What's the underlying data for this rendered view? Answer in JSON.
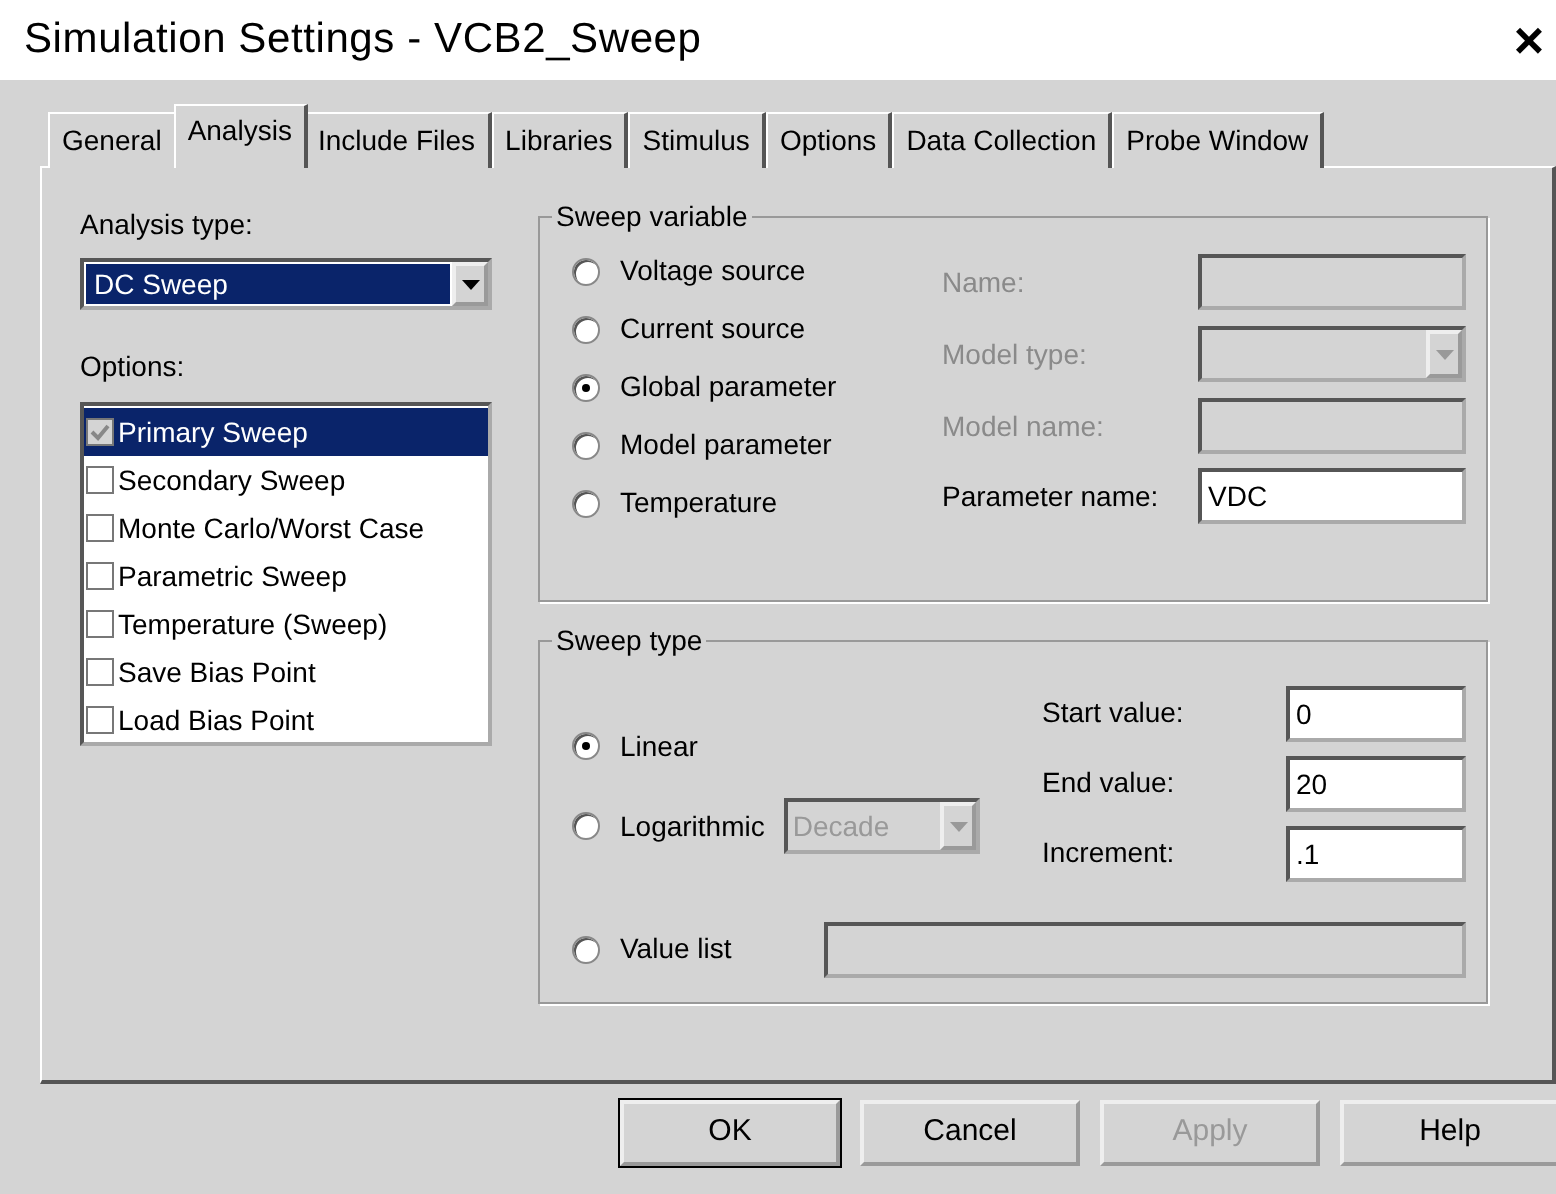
{
  "window": {
    "title": "Simulation Settings - VCB2_Sweep",
    "close": "×"
  },
  "tabs": [
    {
      "label": "General",
      "selected": false
    },
    {
      "label": "Analysis",
      "selected": true
    },
    {
      "label": "Include Files",
      "selected": false
    },
    {
      "label": "Libraries",
      "selected": false
    },
    {
      "label": "Stimulus",
      "selected": false
    },
    {
      "label": "Options",
      "selected": false
    },
    {
      "label": "Data Collection",
      "selected": false
    },
    {
      "label": "Probe Window",
      "selected": false
    }
  ],
  "analysis_type": {
    "label": "Analysis type:",
    "value": "DC Sweep"
  },
  "options": {
    "label": "Options:",
    "items": [
      {
        "label": "Primary Sweep",
        "checked": true,
        "selected": true,
        "disabled": true
      },
      {
        "label": "Secondary Sweep",
        "checked": false,
        "selected": false,
        "disabled": false
      },
      {
        "label": "Monte Carlo/Worst Case",
        "checked": false,
        "selected": false,
        "disabled": false
      },
      {
        "label": "Parametric Sweep",
        "checked": false,
        "selected": false,
        "disabled": false
      },
      {
        "label": "Temperature (Sweep)",
        "checked": false,
        "selected": false,
        "disabled": false
      },
      {
        "label": "Save Bias Point",
        "checked": false,
        "selected": false,
        "disabled": false
      },
      {
        "label": "Load Bias Point",
        "checked": false,
        "selected": false,
        "disabled": false
      }
    ]
  },
  "sweep_variable": {
    "title": "Sweep variable",
    "options": [
      {
        "label": "Voltage source",
        "selected": false
      },
      {
        "label": "Current source",
        "selected": false
      },
      {
        "label": "Global parameter",
        "selected": true
      },
      {
        "label": "Model parameter",
        "selected": false
      },
      {
        "label": "Temperature",
        "selected": false
      }
    ],
    "fields": [
      {
        "label": "Name:",
        "kind": "text",
        "disabled": true
      },
      {
        "label": "Model type:",
        "kind": "select",
        "disabled": true
      },
      {
        "label": "Model name:",
        "kind": "text",
        "disabled": true
      },
      {
        "label": "Parameter name:",
        "kind": "text",
        "disabled": false,
        "value": "VDC"
      }
    ]
  },
  "sweep_type": {
    "title": "Sweep type",
    "options": [
      {
        "label": "Linear",
        "selected": true
      },
      {
        "label": "Logarithmic",
        "selected": false,
        "select": {
          "value": "Decade",
          "disabled": true
        }
      },
      {
        "label": "Value list",
        "selected": false
      }
    ],
    "fields": [
      {
        "label": "Start value:",
        "value": "0"
      },
      {
        "label": "End value:",
        "value": "20"
      },
      {
        "label": "Increment:",
        "value": ".1"
      }
    ],
    "value_list": {
      "disabled": true
    }
  },
  "buttons": [
    {
      "label": "OK",
      "default": true,
      "disabled": false
    },
    {
      "label": "Cancel",
      "default": false,
      "disabled": false
    },
    {
      "label": "Apply",
      "default": false,
      "disabled": true
    },
    {
      "label": "Help",
      "default": false,
      "disabled": false
    }
  ]
}
